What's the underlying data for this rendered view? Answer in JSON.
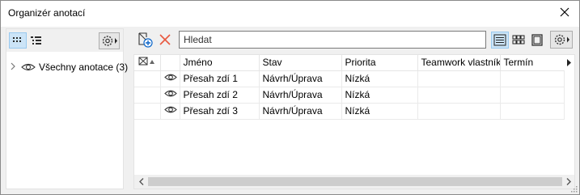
{
  "window": {
    "title": "Organizér anotací"
  },
  "left_panel": {
    "tree": [
      {
        "label": "Všechny anotace (3)",
        "icon": "eye-icon",
        "expanded": false
      }
    ]
  },
  "toolbar": {
    "search_value": "Hledat",
    "icons": [
      "add-annotation-icon",
      "delete-icon",
      "list-view-icon",
      "grid-view-icon",
      "single-view-icon",
      "gear-icon"
    ]
  },
  "table": {
    "columns": [
      "Jméno",
      "Stav",
      "Priorita",
      "Teamwork vlastník",
      "Termín"
    ],
    "rows": [
      {
        "name": "Přesah zdí 1",
        "status": "Návrh/Úprava",
        "priority": "Nízká",
        "owner": "",
        "due": ""
      },
      {
        "name": "Přesah zdí 2",
        "status": "Návrh/Úprava",
        "priority": "Nízká",
        "owner": "",
        "due": ""
      },
      {
        "name": "Přesah zdí 3",
        "status": "Návrh/Úprava",
        "priority": "Nízká",
        "owner": "",
        "due": ""
      }
    ]
  },
  "colors": {
    "accent_bg": "#cce4f7",
    "accent_border": "#99c9ef",
    "delete_red": "#e81123"
  }
}
